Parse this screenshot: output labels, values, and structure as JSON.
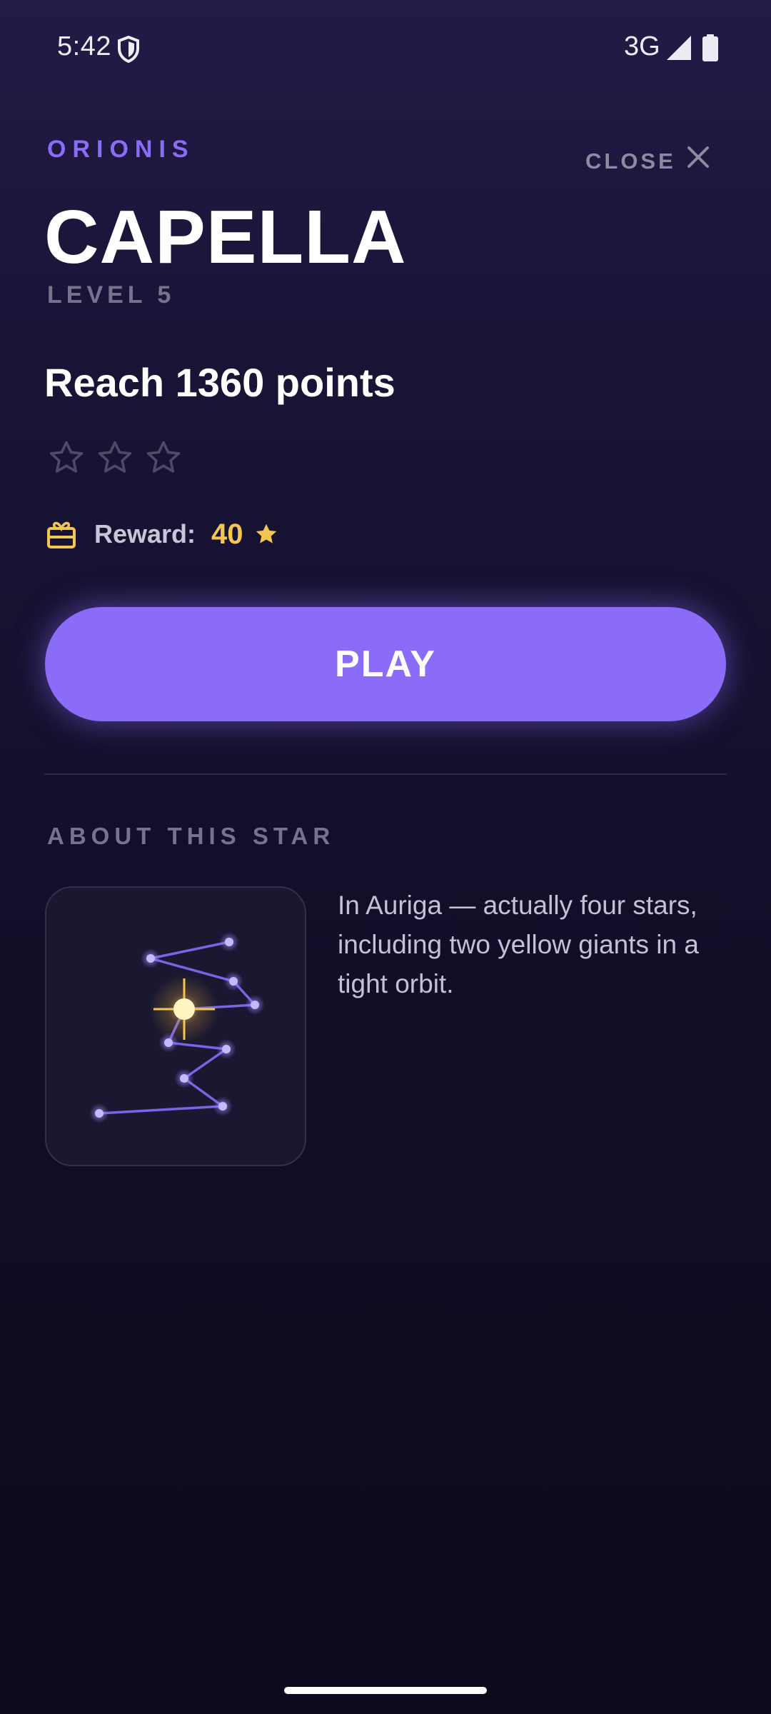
{
  "status_bar": {
    "time": "5:42",
    "network": "3G",
    "icons": [
      "shield-icon",
      "signal-icon",
      "battery-icon"
    ]
  },
  "header": {
    "eyebrow": "ORIONIS",
    "close_label": "CLOSE",
    "title": "CAPELLA",
    "level": "LEVEL 5"
  },
  "goal": {
    "text": "Reach 1360 points",
    "stars_earned": 0,
    "stars_total": 3
  },
  "reward": {
    "label": "Reward:",
    "value": "40",
    "icon": "gift-icon"
  },
  "play": {
    "label": "PLAY"
  },
  "about": {
    "section_title": "ABOUT THIS STAR",
    "description": "In Auriga — actually four stars, including two yellow giants in a tight orbit."
  },
  "colors": {
    "accent": "#8b6cf9",
    "eyebrow": "#8b6cf6",
    "reward_gold": "#f3c64f",
    "muted": "#77738c"
  }
}
